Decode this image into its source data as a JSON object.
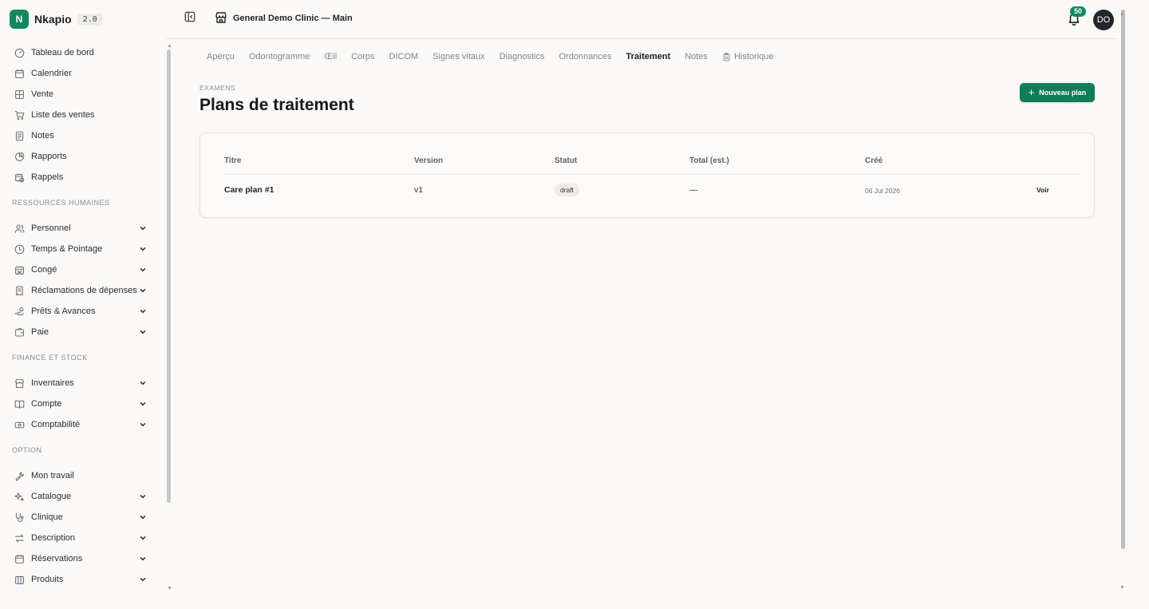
{
  "brand": {
    "logo_letter": "N",
    "name": "Nkapio",
    "version": "2.0"
  },
  "sidebar": {
    "top_items": [
      {
        "label": "Tableau de bord",
        "icon": "dashboard-icon"
      },
      {
        "label": "Calendrier",
        "icon": "calendar-icon"
      },
      {
        "label": "Vente",
        "icon": "grid-icon"
      },
      {
        "label": "Liste des ventes",
        "icon": "cart-icon"
      },
      {
        "label": "Notes",
        "icon": "note-icon"
      },
      {
        "label": "Rapports",
        "icon": "pie-chart-icon"
      },
      {
        "label": "Rappels",
        "icon": "calendar-clock-icon"
      }
    ],
    "sections": [
      {
        "title": "RESSOURCES HUMAINES",
        "items": [
          {
            "label": "Personnel",
            "icon": "users-icon"
          },
          {
            "label": "Temps & Pointage",
            "icon": "clock-icon"
          },
          {
            "label": "Congé",
            "icon": "calendar-off-icon"
          },
          {
            "label": "Réclamations de dépenses",
            "icon": "receipt-icon"
          },
          {
            "label": "Prêts & Avances",
            "icon": "hand-coins-icon"
          },
          {
            "label": "Paie",
            "icon": "wallet-icon"
          }
        ]
      },
      {
        "title": "FINANCE ET STOCK",
        "items": [
          {
            "label": "Inventaires",
            "icon": "store-icon"
          },
          {
            "label": "Compte",
            "icon": "book-icon"
          },
          {
            "label": "Comptabilité",
            "icon": "banknote-icon"
          }
        ]
      },
      {
        "title": "OPTION",
        "items": [
          {
            "label": "Mon travail",
            "icon": "wrench-icon",
            "no_chevron": true
          },
          {
            "label": "Catalogue",
            "icon": "sparkles-icon"
          },
          {
            "label": "Clinique",
            "icon": "stethoscope-icon"
          },
          {
            "label": "Description",
            "icon": "arrows-icon"
          },
          {
            "label": "Réservations",
            "icon": "calendar-icon"
          },
          {
            "label": "Produits",
            "icon": "package-icon"
          }
        ]
      }
    ]
  },
  "header": {
    "clinic_name": "General Demo Clinic — Main",
    "notification_count": "50",
    "avatar_initials": "DO"
  },
  "tabs": [
    {
      "label": "Aperçu",
      "active": false
    },
    {
      "label": "Odontogramme",
      "active": false
    },
    {
      "label": "Œil",
      "active": false
    },
    {
      "label": "Corps",
      "active": false
    },
    {
      "label": "DICOM",
      "active": false
    },
    {
      "label": "Signes vitaux",
      "active": false
    },
    {
      "label": "Diagnostics",
      "active": false
    },
    {
      "label": "Ordonnances",
      "active": false
    },
    {
      "label": "Traitement",
      "active": true
    },
    {
      "label": "Notes",
      "active": false
    },
    {
      "label": "Historique",
      "active": false,
      "icon": "clipboard-icon"
    }
  ],
  "page": {
    "eyebrow": "EXAMENS",
    "title": "Plans de traitement",
    "new_button": "Nouveau plan"
  },
  "table": {
    "headers": {
      "title": "Titre",
      "version": "Version",
      "status": "Statut",
      "total": "Total (est.)",
      "created": "Créé"
    },
    "rows": [
      {
        "title": "Care plan #1",
        "version": "v1",
        "status": "draft",
        "total": "—",
        "created": "06 Jul 2026",
        "action": "Voir"
      }
    ]
  },
  "colors": {
    "accent": "#0f7d58",
    "background": "#faf9f7",
    "avatar": "#22262b"
  }
}
